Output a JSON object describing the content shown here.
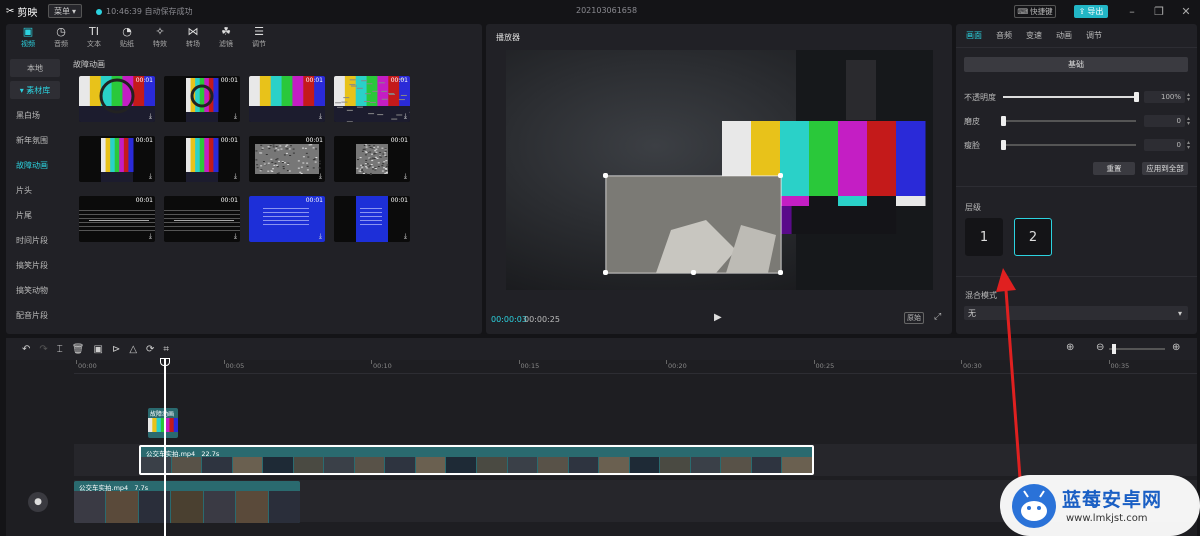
{
  "app": {
    "name": "剪映",
    "menu_label": "菜单",
    "save_status": "10:46:39 自动保存成功",
    "project_title": "202103061658",
    "shortcut_label": "快捷键",
    "export_label": "导出"
  },
  "library": {
    "tabs": [
      {
        "label": "视频",
        "icon": "video-icon",
        "active": true
      },
      {
        "label": "音频",
        "icon": "audio-icon"
      },
      {
        "label": "文本",
        "icon": "text-icon"
      },
      {
        "label": "贴纸",
        "icon": "sticker-icon"
      },
      {
        "label": "特效",
        "icon": "effects-icon"
      },
      {
        "label": "转场",
        "icon": "transition-icon"
      },
      {
        "label": "滤镜",
        "icon": "filter-icon"
      },
      {
        "label": "调节",
        "icon": "adjust-icon"
      }
    ],
    "sidebar": [
      {
        "label": "本地"
      },
      {
        "label": "▾ 素材库"
      },
      {
        "label": "黑白场"
      },
      {
        "label": "新年氛围"
      },
      {
        "label": "故障动画",
        "active": true
      },
      {
        "label": "片头"
      },
      {
        "label": "片尾"
      },
      {
        "label": "时间片段"
      },
      {
        "label": "搞笑片段"
      },
      {
        "label": "搞笑动物"
      },
      {
        "label": "配音片段"
      }
    ],
    "section_title": "故障动画",
    "items": [
      {
        "duration": "00:01",
        "style": "testcard"
      },
      {
        "duration": "00:01",
        "style": "testcard-small"
      },
      {
        "duration": "00:01",
        "style": "bars"
      },
      {
        "duration": "00:01",
        "style": "bars-noise"
      },
      {
        "duration": "00:01",
        "style": "bars-small"
      },
      {
        "duration": "00:01",
        "style": "bars-small"
      },
      {
        "duration": "00:01",
        "style": "static"
      },
      {
        "duration": "00:01",
        "style": "static-small"
      },
      {
        "duration": "00:01",
        "style": "scanline"
      },
      {
        "duration": "00:01",
        "style": "scanline-small"
      },
      {
        "duration": "00:01",
        "style": "bluescreen"
      },
      {
        "duration": "00:01",
        "style": "bluescreen-small"
      }
    ]
  },
  "player": {
    "title": "播放器",
    "current_time": "00:00:03",
    "total_time": "00:00:25",
    "ratio_label": "原始"
  },
  "properties": {
    "tabs": [
      "画面",
      "音频",
      "变速",
      "动画",
      "调节"
    ],
    "basic_label": "基础",
    "rows": [
      {
        "label": "不透明度",
        "value": "100%",
        "fraction": 1.0
      },
      {
        "label": "磨皮",
        "value": "0",
        "fraction": 0
      },
      {
        "label": "瘦脸",
        "value": "0",
        "fraction": 0
      }
    ],
    "reset_label": "重置",
    "apply_all_label": "应用到全部",
    "layer_title": "层级",
    "layers": [
      "1",
      "2"
    ],
    "blend_title": "混合模式",
    "blend_value": "无"
  },
  "timeline": {
    "ruler": [
      "00:00",
      "00:05",
      "00:10",
      "00:15",
      "00:20",
      "00:25",
      "00:30",
      "00:35"
    ],
    "sticker_label": "故障动画",
    "clip1": {
      "name": "公交车实拍.mp4",
      "duration": "22.7s"
    },
    "clip2": {
      "name": "公交车实拍.mp4",
      "duration": "7.7s"
    }
  },
  "watermark": {
    "brand": "蓝莓安卓网",
    "url": "www.lmkjst.com"
  }
}
